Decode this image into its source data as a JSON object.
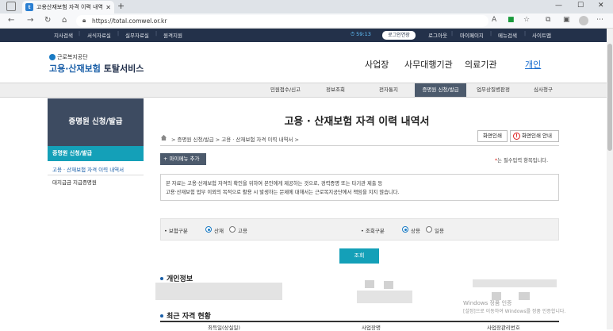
{
  "browser": {
    "tab_title": "고용산재보험 자격 이력 내역서",
    "url": "https://total.comwel.or.kr"
  },
  "topbar": {
    "links": [
      "지사검색",
      "서식자료실",
      "실무자료실",
      "원격지원"
    ],
    "timer": "59:13",
    "extend_label": "로그인연장",
    "right_links": [
      "로그아웃",
      "마이페이지",
      "메뉴검색",
      "사이트맵"
    ]
  },
  "header": {
    "org_name": "근로복지공단",
    "service_name_a": "고용·산재보험",
    "service_name_b": " 토탈서비스",
    "gnb": [
      "사업장",
      "사무대행기관",
      "의료기관",
      "개인"
    ],
    "gnb_active": "개인"
  },
  "menubar": {
    "items": [
      "민원접수/신고",
      "정보조회",
      "전자통지",
      "증명원 신청/발급",
      "업무상질병판정",
      "심사청구"
    ],
    "active": "증명원 신청/발급"
  },
  "sidebar": {
    "title": "증명원 신청/발급",
    "selected": "증명원 신청/발급",
    "items": [
      "고용 · 산재보험 자격 이력 내역서",
      "대지급금 지급증명원"
    ]
  },
  "content": {
    "title": "고용 · 산재보험 자격 이력 내역서",
    "breadcrumb": [
      "증명원 신청/발급",
      "고용 · 산재보험 자격 이력 내역서"
    ],
    "print_label": "화면인쇄",
    "print_guide_label": "화면인쇄 안내",
    "mymenu_label": "+ 마이메뉴 추가",
    "required_note": "는 필수입력 항목입니다.",
    "notice_line1": "본 자료는 고용·산재보험 자격의 확인을 위하여 본인에게 제공하는 것으로, 경력증명 또는 타기관 제출 등",
    "notice_line2": "고용·산재보험 업무 이외의 목적으로 활용 시 발생하는 문제에 대해서는 근로복지공단에서 책임을 지지 않습니다.",
    "insurance_label": "• 보험구분",
    "insurance_options": [
      "산재",
      "고용"
    ],
    "insurance_selected": "산재",
    "inquiry_label": "• 조회구분",
    "inquiry_options": [
      "상용",
      "일용"
    ],
    "inquiry_selected": "상용",
    "query_button": "조회",
    "personal_info_title": "개인정보",
    "recent_title": "최근 자격 현황",
    "table_headers": [
      "최득일(상실일)",
      "사업장명",
      "사업장관리번호"
    ],
    "watermark_line1": "Windows 정품 인증",
    "watermark_line2": "[설정]으로 이동하여 Windows를 정품 인증합니다."
  }
}
